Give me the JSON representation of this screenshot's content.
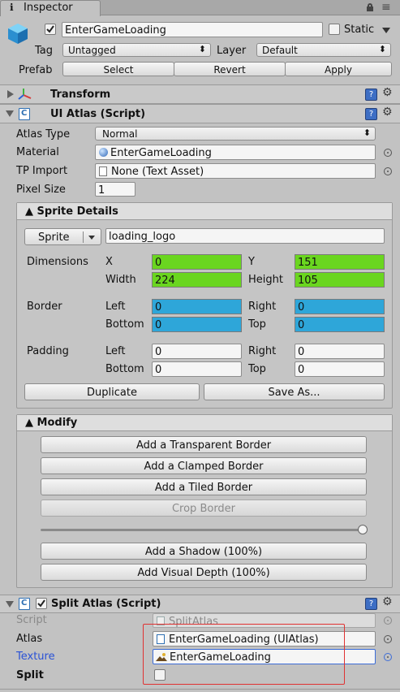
{
  "window": {
    "tab_title": "Inspector",
    "info_glyph": "ℹ",
    "lock_glyph": "🔒",
    "menu_glyph": "≡"
  },
  "header": {
    "object_name": "EnterGameLoading",
    "active_checked": true,
    "static_label": "Static",
    "static_checked": false,
    "tag_label": "Tag",
    "tag_value": "Untagged",
    "layer_label": "Layer",
    "layer_value": "Default",
    "prefab_label": "Prefab",
    "prefab_buttons": [
      "Select",
      "Revert",
      "Apply"
    ]
  },
  "components": {
    "transform": {
      "title": "Transform"
    },
    "ui_atlas": {
      "title": "UI Atlas (Script)",
      "atlas_type_label": "Atlas Type",
      "atlas_type_value": "Normal",
      "material_label": "Material",
      "material_value": "EnterGameLoading",
      "tp_import_label": "TP Import",
      "tp_import_value": "None (Text Asset)",
      "pixel_size_label": "Pixel Size",
      "pixel_size_value": "1"
    },
    "split_atlas": {
      "title": "Split Atlas (Script)",
      "enabled": true,
      "script_label": "Script",
      "script_value": "SplitAtlas",
      "atlas_label": "Atlas",
      "atlas_value": "EnterGameLoading (UIAtlas)",
      "texture_label": "Texture",
      "texture_value": "EnterGameLoading",
      "split_label": "Split",
      "split_checked": false
    }
  },
  "sprite_details": {
    "title": "▲ Sprite Details",
    "sprite_button": "Sprite",
    "sprite_name": "loading_logo",
    "dimensions_label": "Dimensions",
    "x_label": "X",
    "x_value": "0",
    "y_label": "Y",
    "y_value": "151",
    "width_label": "Width",
    "width_value": "224",
    "height_label": "Height",
    "height_value": "105",
    "border_label": "Border",
    "border": {
      "left_label": "Left",
      "left": "0",
      "right_label": "Right",
      "right": "0",
      "bottom_label": "Bottom",
      "bottom": "0",
      "top_label": "Top",
      "top": "0"
    },
    "padding_label": "Padding",
    "padding": {
      "left_label": "Left",
      "left": "0",
      "right_label": "Right",
      "right": "0",
      "bottom_label": "Bottom",
      "bottom": "0",
      "top_label": "Top",
      "top": "0"
    },
    "duplicate_button": "Duplicate",
    "save_as_button": "Save As..."
  },
  "modify": {
    "title": "▲ Modify",
    "buttons": [
      "Add a Transparent Border",
      "Add a Clamped Border",
      "Add a Tiled Border"
    ],
    "crop_button": "Crop Border",
    "slider_value": 1.0,
    "shadow_button": "Add a Shadow (100%)",
    "depth_button": "Add Visual Depth (100%)"
  },
  "colors": {
    "green_field": "#6ad61f",
    "blue_field": "#2ea6d9",
    "highlight_red": "#e03232",
    "label_blue": "#2a52d6"
  }
}
